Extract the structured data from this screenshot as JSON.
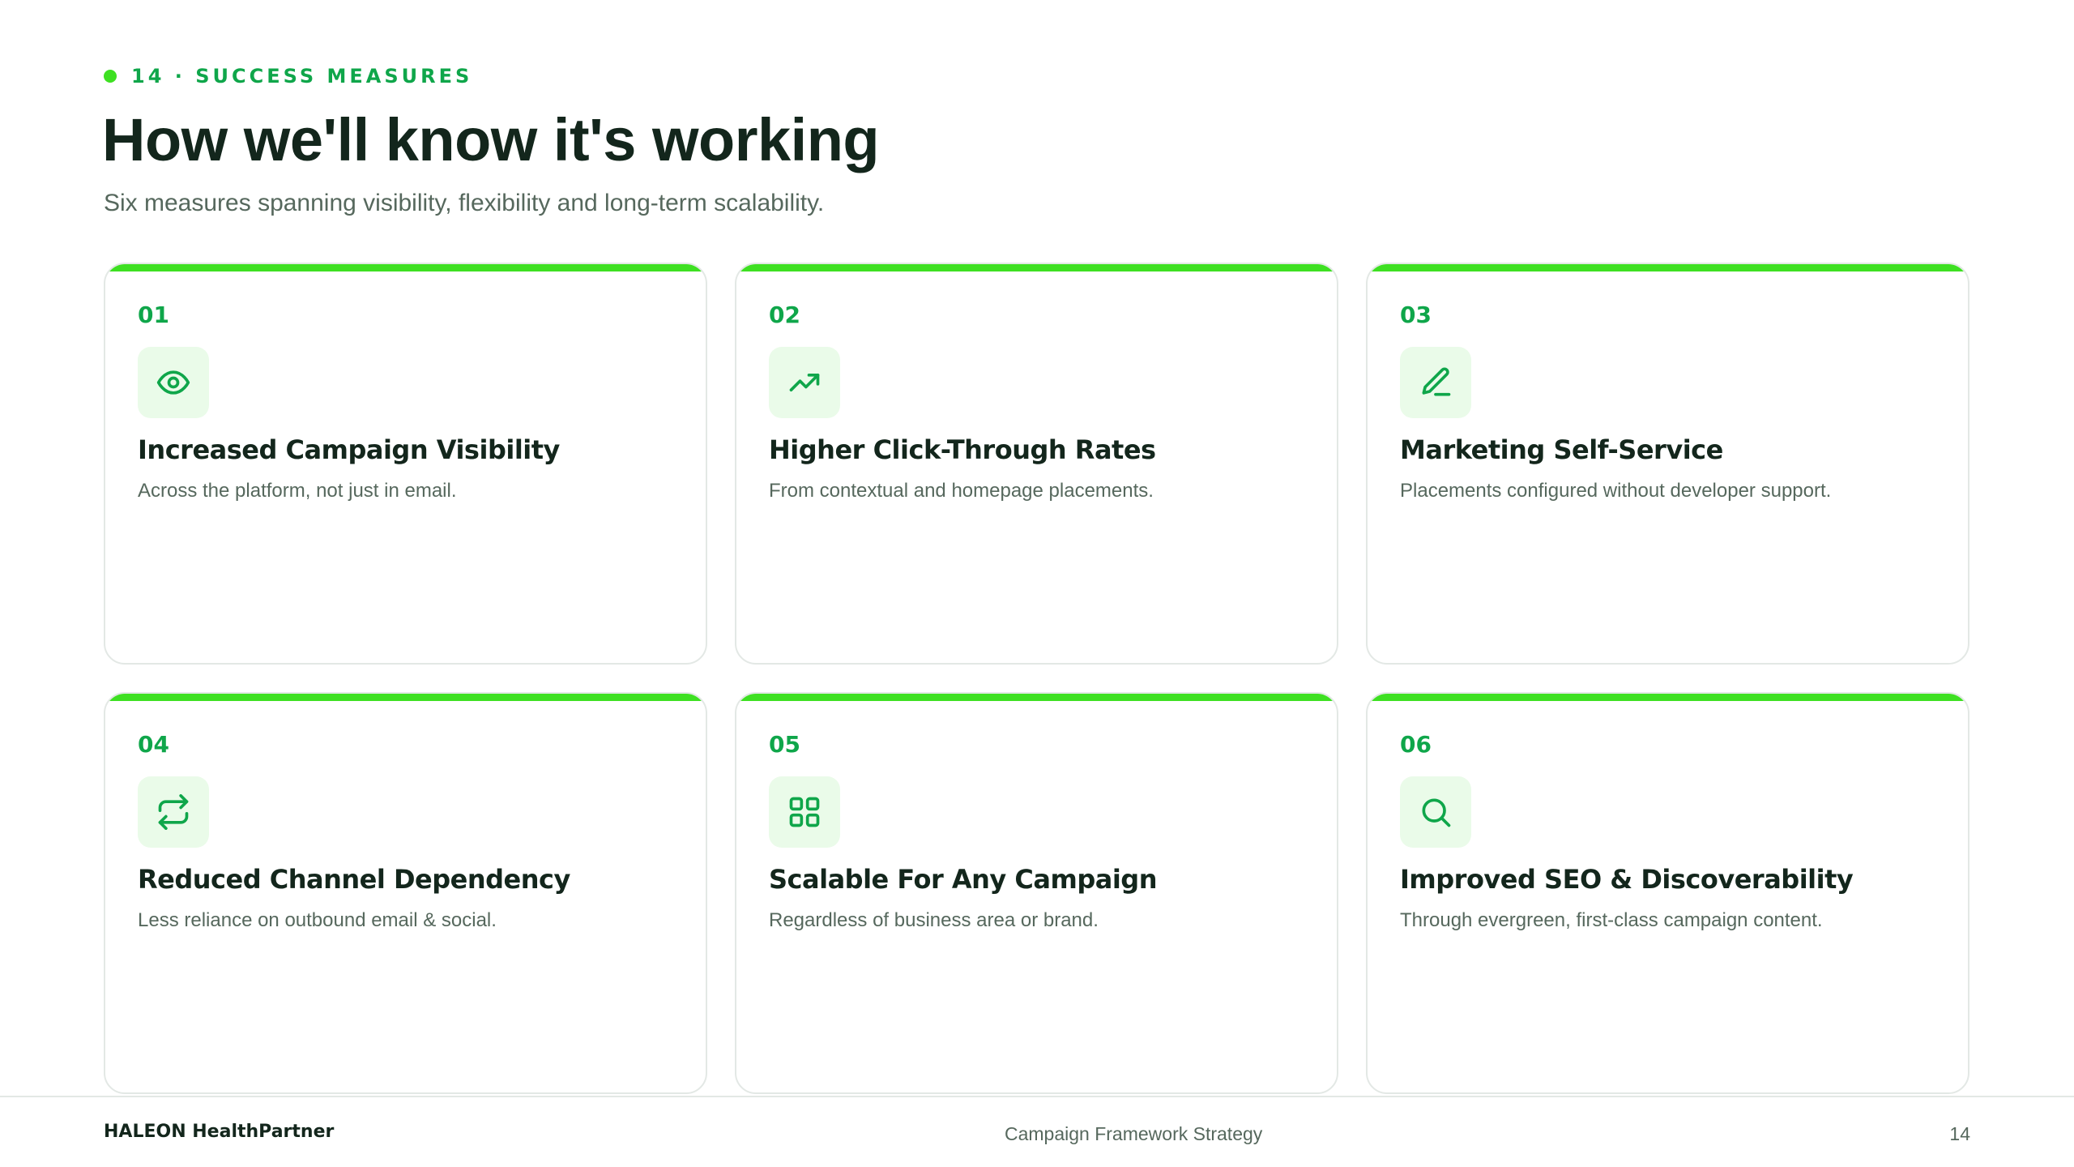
{
  "header": {
    "eyebrow": "14 · SUCCESS MEASURES",
    "title": "How we'll know it's working",
    "subtitle": "Six measures spanning visibility, flexibility and long-term scalability."
  },
  "colors": {
    "accent": "#3ee022",
    "accent_dark": "#0fa64a",
    "icon_bg": "#eafbe9",
    "text_dark": "#13261c",
    "text_muted": "#56685d"
  },
  "cards": [
    {
      "number": "01",
      "icon": "eye-icon",
      "title": "Increased Campaign Visibility",
      "description": "Across the platform, not just in email."
    },
    {
      "number": "02",
      "icon": "trending-up-icon",
      "title": "Higher Click-Through Rates",
      "description": "From contextual and homepage placements."
    },
    {
      "number": "03",
      "icon": "pencil-icon",
      "title": "Marketing Self-Service",
      "description": "Placements configured without developer support."
    },
    {
      "number": "04",
      "icon": "repeat-icon",
      "title": "Reduced Channel Dependency",
      "description": "Less reliance on outbound email & social."
    },
    {
      "number": "05",
      "icon": "grid-icon",
      "title": "Scalable For Any Campaign",
      "description": "Regardless of business area or brand."
    },
    {
      "number": "06",
      "icon": "search-icon",
      "title": "Improved SEO & Discoverability",
      "description": "Through evergreen, first-class campaign content."
    }
  ],
  "footer": {
    "brand": "HALEON HealthPartner",
    "center": "Campaign Framework Strategy",
    "page": "14"
  }
}
